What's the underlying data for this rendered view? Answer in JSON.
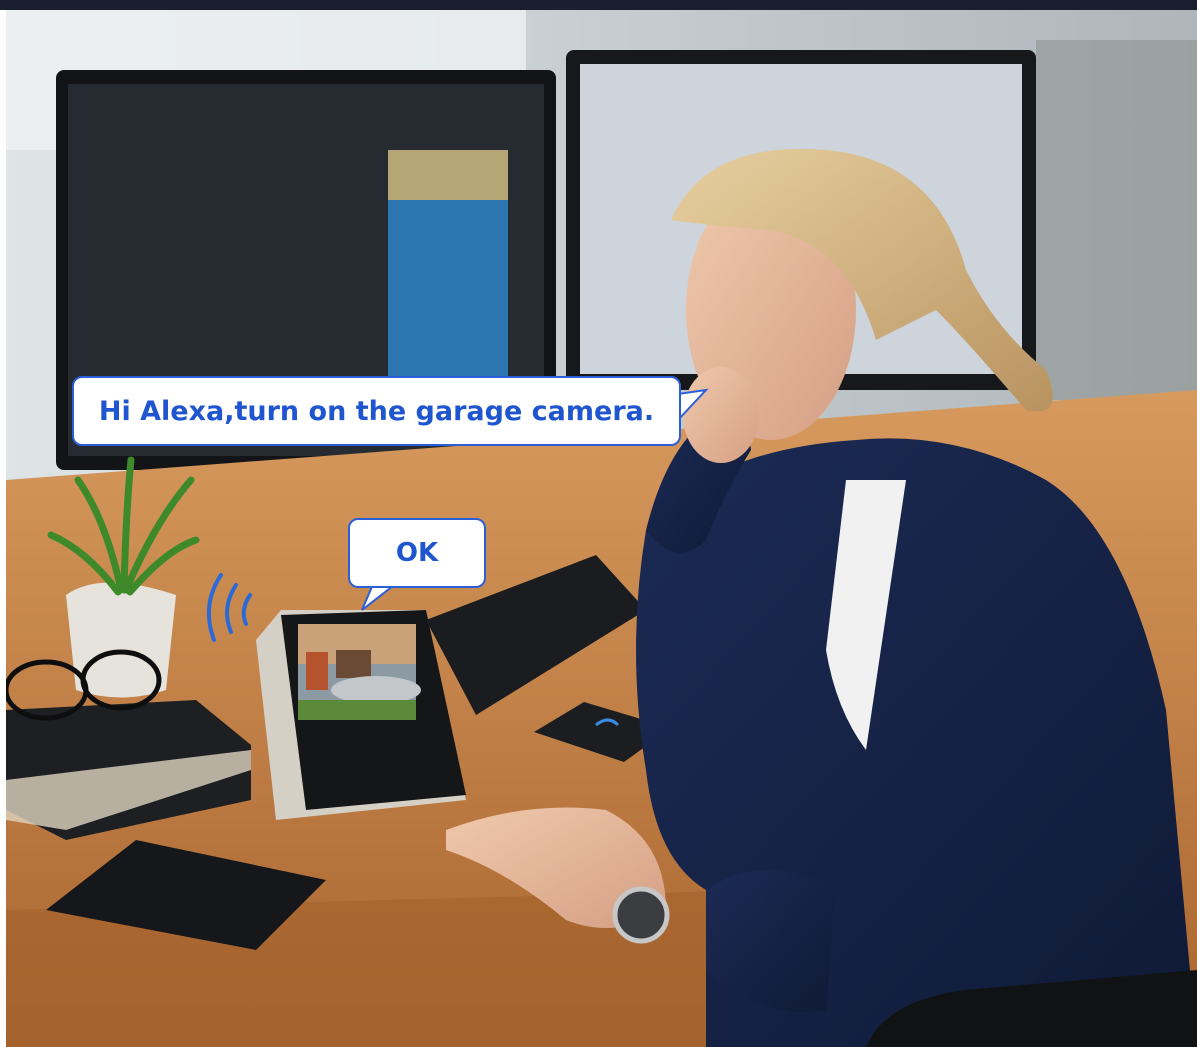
{
  "speech": {
    "user": "Hi Alexa,turn on the garage camera.",
    "device": "OK"
  },
  "colors": {
    "bubble_border": "#2b5fd9",
    "bubble_text": "#1f56d0",
    "top_bar": "#1a1e2e"
  }
}
